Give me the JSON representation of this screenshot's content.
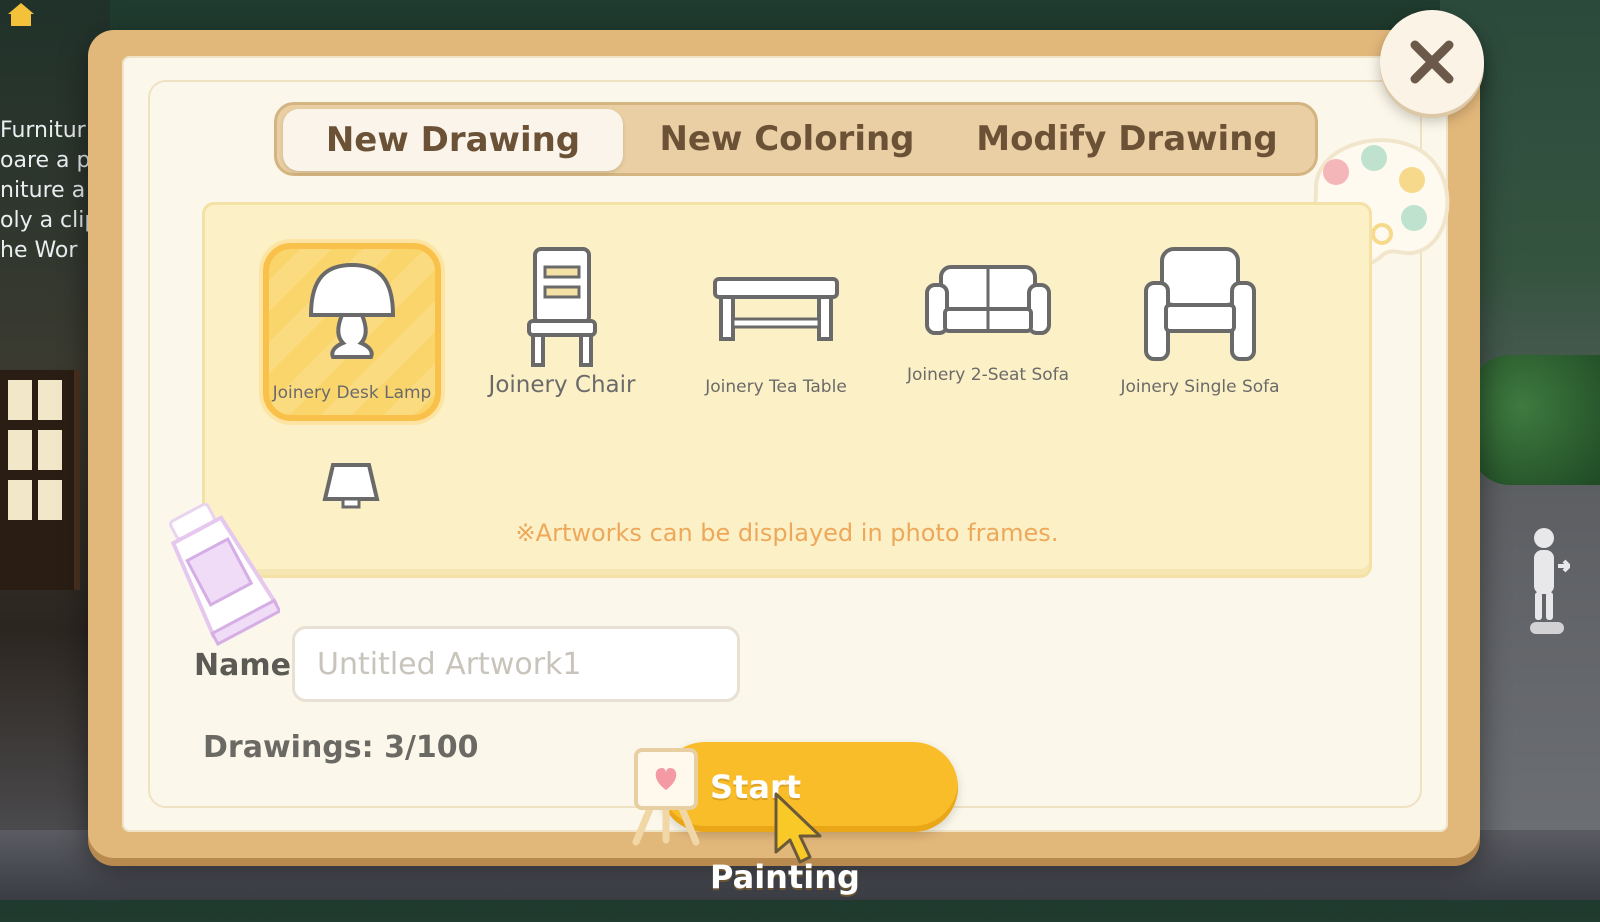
{
  "background": {
    "left_text_lines": [
      "Furnitur",
      "oare a p",
      "niture a",
      "oly a clip",
      "he Wor"
    ]
  },
  "dialog": {
    "tabs": [
      {
        "label": "New Drawing",
        "active": true
      },
      {
        "label": "New Coloring",
        "active": false
      },
      {
        "label": "Modify Drawing",
        "active": false
      }
    ],
    "items": [
      {
        "label": "Joinery Desk Lamp",
        "icon": "desk-lamp-icon",
        "selected": true
      },
      {
        "label": "Joinery Chair",
        "icon": "chair-icon",
        "selected": false
      },
      {
        "label": "Joinery Tea Table",
        "icon": "tea-table-icon",
        "selected": false
      },
      {
        "label": "Joinery 2-Seat Sofa",
        "icon": "two-seat-sofa-icon",
        "selected": false
      },
      {
        "label": "Joinery Single Sofa",
        "icon": "single-sofa-icon",
        "selected": false
      }
    ],
    "note": "※Artworks can be displayed in photo frames.",
    "name_label": "Name",
    "name_placeholder": "Untitled Artwork1",
    "drawings_count": "Drawings: 3/100",
    "start_button": "Start Painting",
    "colors": {
      "accent": "#f9bd2a",
      "selected_item": "#f9c14a",
      "note_text": "#eda85b",
      "panel_frame": "#e2b77a"
    }
  }
}
